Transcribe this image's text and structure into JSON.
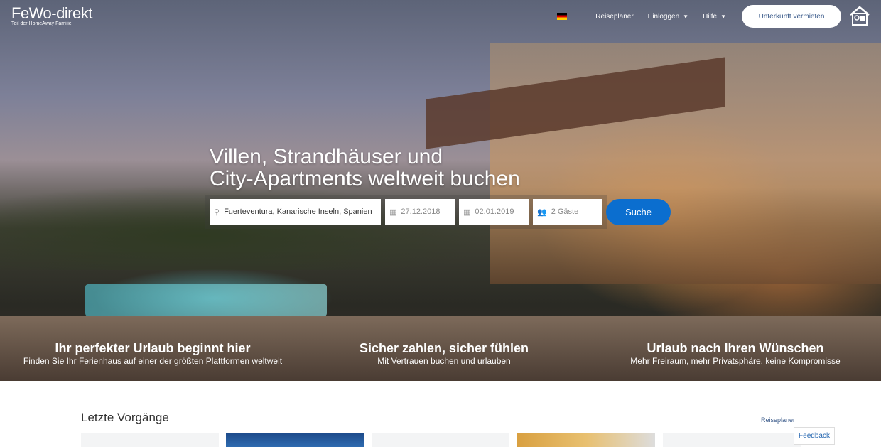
{
  "header": {
    "logo": "FeWo-direkt",
    "logo_sub": "Teil der HomeAway Familie",
    "language_flag": "de-flag-icon",
    "nav": {
      "trip_planner": "Reiseplaner",
      "login": "Einloggen",
      "help": "Hilfe",
      "rent_button": "Unterkunft vermieten"
    }
  },
  "hero": {
    "title_line1": "Villen, Strandhäuser und",
    "title_line2": "City-Apartments weltweit buchen"
  },
  "search": {
    "destination": "Fuerteventura, Kanarische Inseln, Spanien",
    "checkin": "27.12.2018",
    "checkout": "02.01.2019",
    "guests": "2 Gäste",
    "button": "Suche"
  },
  "features": [
    {
      "title": "Ihr perfekter Urlaub beginnt hier",
      "text": "Finden Sie Ihr Ferienhaus auf einer der größten Plattformen weltweit"
    },
    {
      "title": "Sicher zahlen, sicher fühlen",
      "text": "Mit Vertrauen buchen und urlauben"
    },
    {
      "title": "Urlaub nach Ihren Wünschen",
      "text": "Mehr Freiraum, mehr Privatsphäre, keine Kompromisse"
    }
  ],
  "recent": {
    "title": "Letzte Vorgänge",
    "link": "Reiseplaner"
  },
  "feedback": "Feedback",
  "colors": {
    "accent": "#0b6ecf",
    "link": "#3a5a8a"
  }
}
